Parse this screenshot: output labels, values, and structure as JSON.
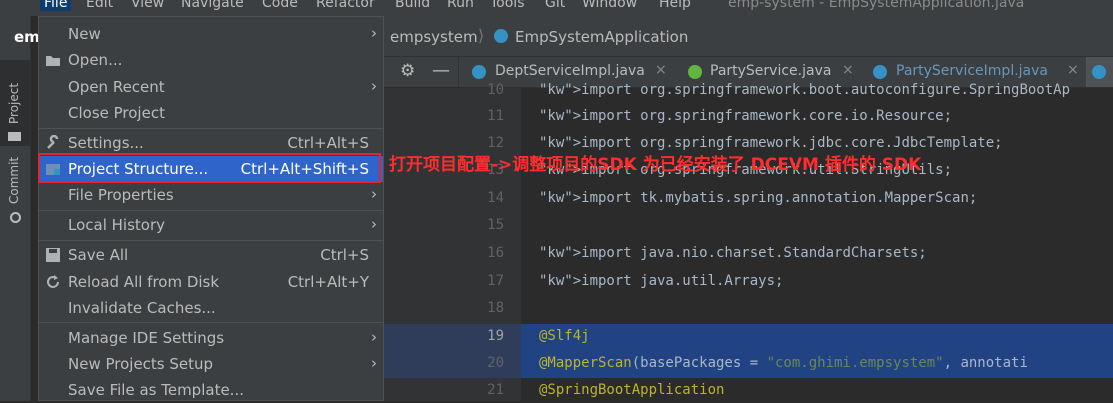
{
  "menubar": {
    "items": [
      "File",
      "Edit",
      "View",
      "Navigate",
      "Code",
      "Refactor",
      "Build",
      "Run",
      "Tools",
      "Git",
      "Window",
      "Help"
    ],
    "window_title": "emp-system - EmpSystemApplication.java"
  },
  "toolstrip": {
    "project_label": "Project",
    "commit_label": "Commit"
  },
  "project_panel": {
    "title": "emp"
  },
  "breadcrumb": {
    "project": "empsystem",
    "file": "EmpSystemApplication"
  },
  "tabs": [
    {
      "label": "DeptServiceImpl.java",
      "icon": "class-icon",
      "color": "#3592c4",
      "text_color": "#bbbbbb"
    },
    {
      "label": "PartyService.java",
      "icon": "interface-icon",
      "color": "#62b543",
      "text_color": "#bbbbbb"
    },
    {
      "label": "PartyServiceImpl.java",
      "icon": "class-icon",
      "color": "#3592c4",
      "text_color": "#6897bb"
    }
  ],
  "file_menu": {
    "items": [
      {
        "label": "New",
        "has_submenu": true
      },
      {
        "label": "Open..."
      },
      {
        "label": "Open Recent",
        "has_submenu": true
      },
      {
        "label": "Close Project"
      },
      {
        "label": "Settings...",
        "shortcut": "Ctrl+Alt+S"
      },
      {
        "label": "Project Structure...",
        "shortcut": "Ctrl+Alt+Shift+S",
        "selected": true
      },
      {
        "label": "File Properties",
        "has_submenu": true
      },
      {
        "label": "Local History",
        "has_submenu": true
      },
      {
        "label": "Save All",
        "shortcut": "Ctrl+S"
      },
      {
        "label": "Reload All from Disk",
        "shortcut": "Ctrl+Alt+Y"
      },
      {
        "label": "Invalidate Caches..."
      },
      {
        "label": "Manage IDE Settings",
        "has_submenu": true
      },
      {
        "label": "New Projects Setup",
        "has_submenu": true
      },
      {
        "label": "Save File as Template..."
      }
    ]
  },
  "annotation": "打开项目配置->调整项目的SDK 为已经安装了 DCEVM 插件的 SDK",
  "code": {
    "lines": [
      {
        "no": "10",
        "text": "import org.springframework.boot.autoconfigure.SpringBootAp"
      },
      {
        "no": "11",
        "text": "import org.springframework.core.io.Resource;"
      },
      {
        "no": "12",
        "text": "import org.springframework.jdbc.core.JdbcTemplate;"
      },
      {
        "no": "13",
        "text": "import org.springframework.util.StringUtils;"
      },
      {
        "no": "14",
        "text": "import tk.mybatis.spring.annotation.MapperScan;"
      },
      {
        "no": "15",
        "text": ""
      },
      {
        "no": "16",
        "text": "import java.nio.charset.StandardCharsets;"
      },
      {
        "no": "17",
        "text": "import java.util.Arrays;"
      },
      {
        "no": "18",
        "text": ""
      },
      {
        "no": "19",
        "text": "@Slf4j"
      },
      {
        "no": "20",
        "text": "@MapperScan(basePackages = \"com.ghimi.empsystem\", annotati"
      },
      {
        "no": "21",
        "text": "@SpringBootApplication"
      }
    ]
  }
}
